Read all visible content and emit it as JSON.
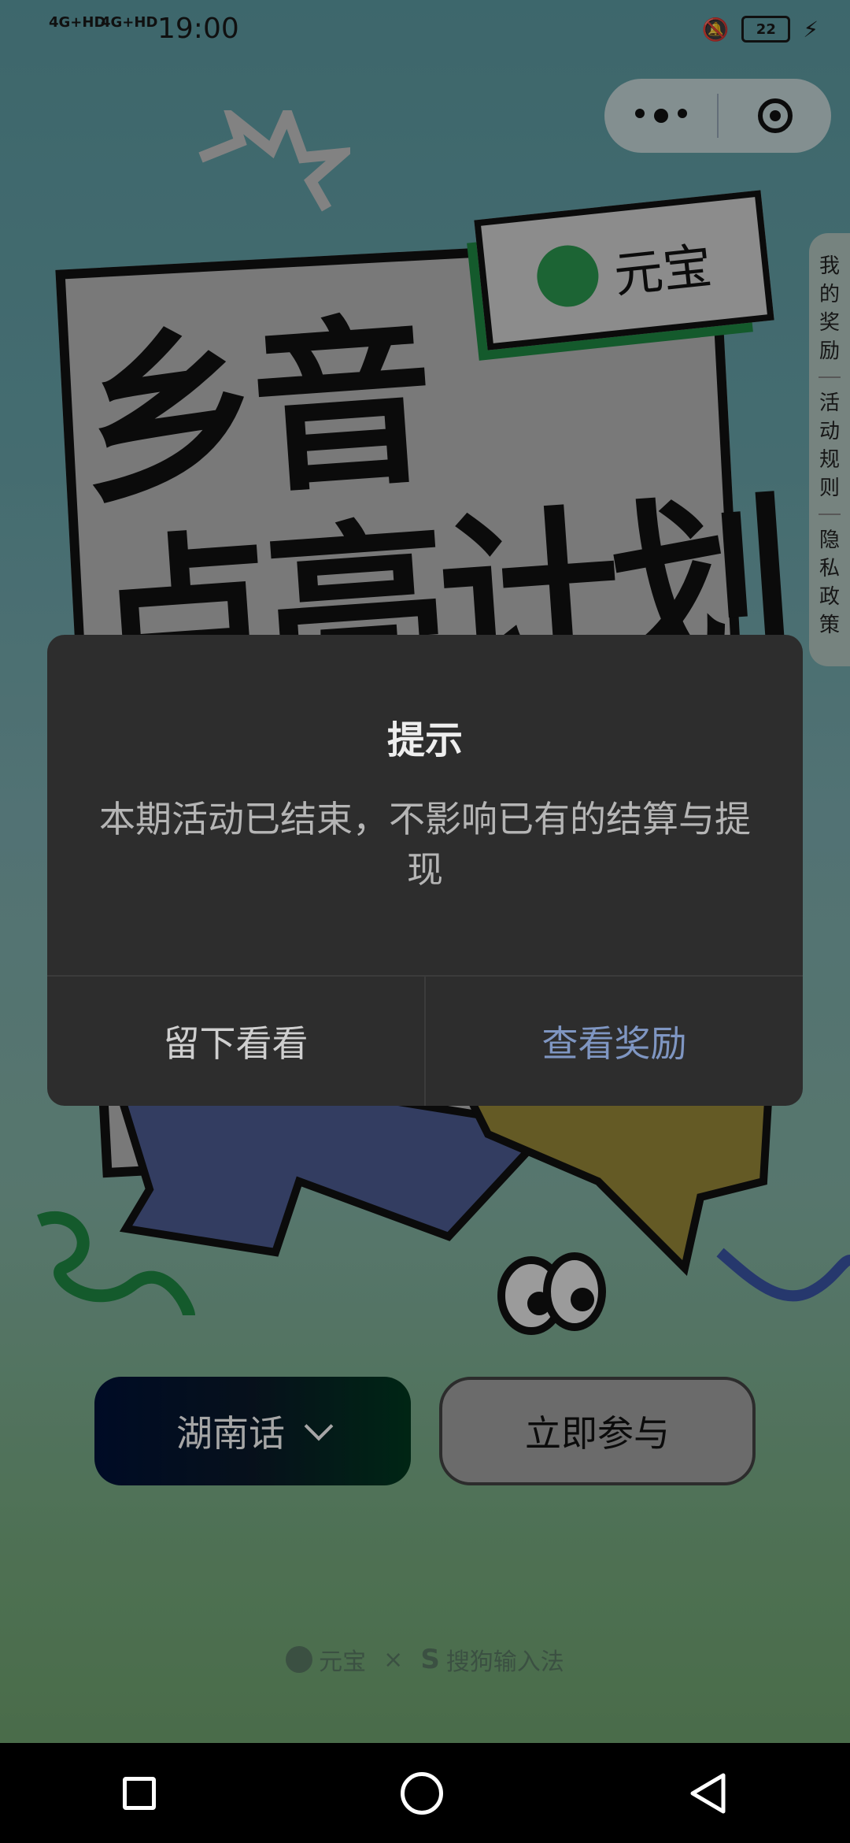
{
  "status_bar": {
    "signal_1": "4G+HD",
    "signal_2": "4G+HD",
    "time": "19:00",
    "battery": "22"
  },
  "side_menu": {
    "items": [
      "我的奖励",
      "活动规则",
      "隐私政策"
    ]
  },
  "poster": {
    "brand_bubble": "元宝",
    "title_line1": "乡音",
    "title_line2": "点亮计划"
  },
  "actions": {
    "dialect_select": "湖南话",
    "join_button": "立即参与"
  },
  "footer": {
    "brand_left": "元宝",
    "separator": "×",
    "brand_right": "搜狗输入法"
  },
  "dialog": {
    "title": "提示",
    "message": "本期活动已结束，不影响已有的结算与提现",
    "stay_button": "留下看看",
    "reward_button": "查看奖励"
  },
  "colors": {
    "dialog_bg": "#2d2d2d",
    "dialog_accent": "#7f96c2",
    "brand_green": "#2c9a50"
  }
}
